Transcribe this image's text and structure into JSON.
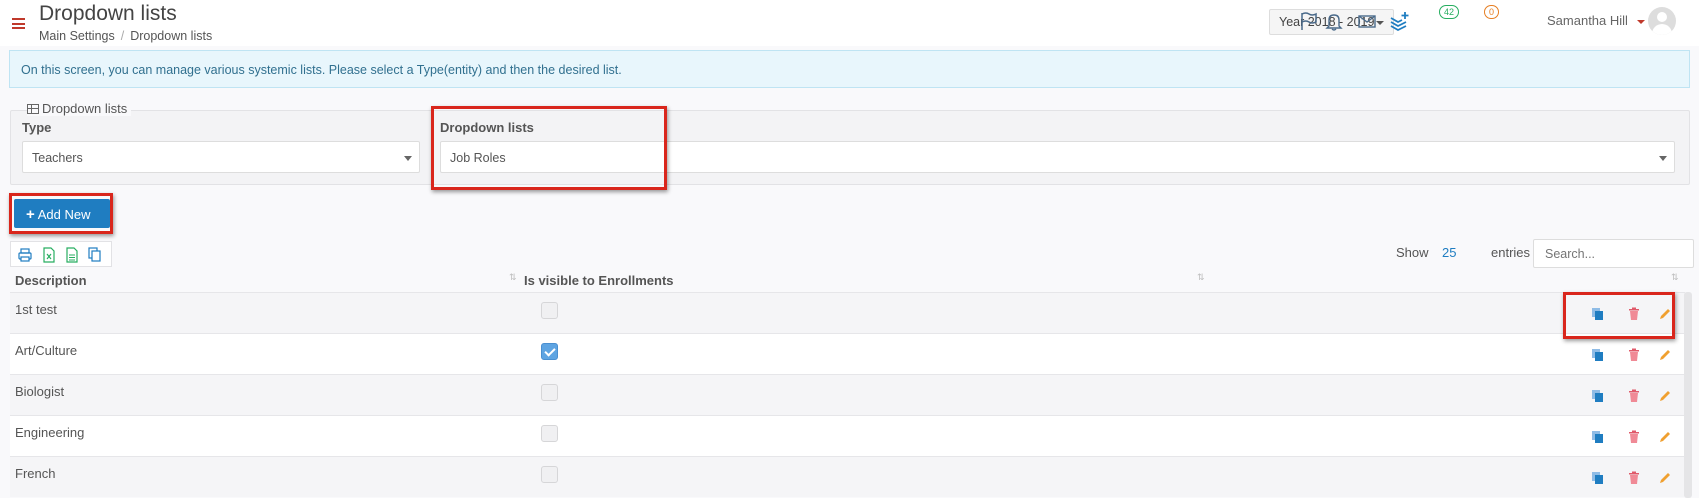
{
  "header": {
    "title": "Dropdown lists",
    "breadcrumb": [
      "Main Settings",
      "/",
      "Dropdown lists"
    ],
    "year_selector": "Year 2018 - 2019",
    "notifications_count": "42",
    "messages_count": "0",
    "user_name": "Samantha Hill",
    "accent_color": "#c0392b"
  },
  "info_message": "On this screen, you can manage various systemic lists. Please select a Type(entity) and then the desired list.",
  "filter_panel": {
    "legend": "Dropdown lists",
    "type_label": "Type",
    "type_value": "Teachers",
    "list_label": "Dropdown lists",
    "list_value": "Job Roles"
  },
  "toolbar": {
    "add_new_label": "Add New",
    "export_icons": [
      "print-icon",
      "excel-icon",
      "csv-icon",
      "copy-icon"
    ],
    "show_label": "Show",
    "show_value": "25",
    "entries_label": "entries",
    "search_placeholder": "Search..."
  },
  "table": {
    "columns": [
      "Description",
      "Is visible to Enrollments"
    ],
    "rows": [
      {
        "description": "1st test",
        "visible": false
      },
      {
        "description": "Art/Culture",
        "visible": true
      },
      {
        "description": "Biologist",
        "visible": false
      },
      {
        "description": "Engineering",
        "visible": false
      },
      {
        "description": "French",
        "visible": false
      }
    ],
    "row_actions": [
      "copy-icon",
      "trash-icon",
      "edit-icon"
    ]
  },
  "colors": {
    "primary": "#1f7dc1",
    "highlight_box": "#d9261c",
    "info_bg": "#e8f6fc",
    "delete": "#e05a6a",
    "edit": "#f0a030"
  }
}
